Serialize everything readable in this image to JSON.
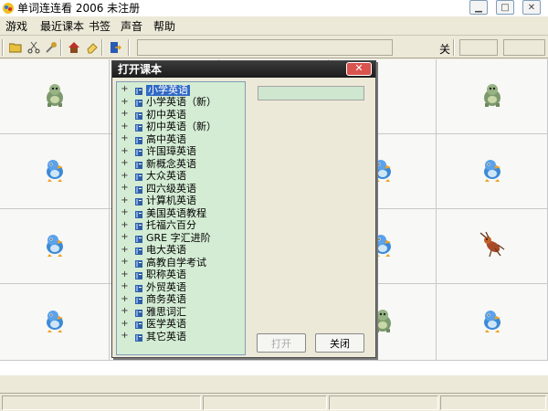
{
  "window": {
    "title": "单词连连看 2006 未注册"
  },
  "titlebar": {
    "minimize_glyph": "▁",
    "maximize_glyph": "□",
    "close_glyph": "✕"
  },
  "menu": {
    "items": [
      "游戏",
      "最近课本",
      "书签",
      "声音",
      "帮助"
    ]
  },
  "toolbar": {
    "buttons": [
      "folder-open-icon",
      "scissors-icon",
      "tools-icon",
      "house-icon",
      "eraser-icon",
      "exit-door-icon"
    ],
    "close_label": "关"
  },
  "board": {
    "cells": [
      "turtle-icon",
      "empty",
      "empty",
      "empty",
      "turtle-icon",
      "bird-icon",
      "empty",
      "empty",
      "bird-icon",
      "bird-icon",
      "bird-icon",
      "empty",
      "empty",
      "bird-icon",
      "cricket-icon",
      "bird-icon",
      "empty",
      "empty",
      "turtle-icon",
      "bird-icon"
    ]
  },
  "dialog": {
    "title": "打开课本",
    "close_glyph": "✕",
    "tree_expander": "+",
    "tree_items": [
      "小学英语",
      "小学英语（新）",
      "初中英语",
      "初中英语（新）",
      "高中英语",
      "许国璋英语",
      "新概念英语",
      "大众英语",
      "四六级英语",
      "计算机英语",
      "美国英语教程",
      "托福六百分",
      "GRE 字汇进阶",
      "电大英语",
      "高教自学考试",
      "职称英语",
      "外贸英语",
      "商务英语",
      "雅思词汇",
      "医学英语",
      "其它英语"
    ],
    "selected_index": 0,
    "open_label": "打开",
    "close_label": "关闭"
  },
  "colors": {
    "tree_bg": "#d4ecd4",
    "selection": "#316ac5",
    "dialog_title_bg": "#1c1c1c",
    "close_red": "#d9534f"
  }
}
